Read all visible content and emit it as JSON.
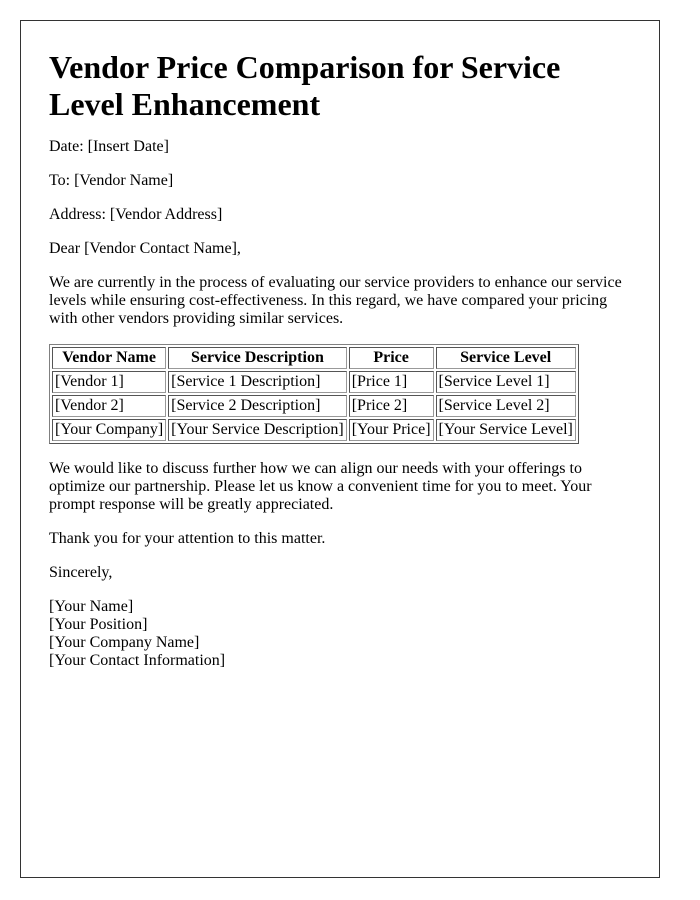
{
  "letter": {
    "title": "Vendor Price Comparison for Service Level Enhancement",
    "date_line": "Date: [Insert Date]",
    "to_line": "To: [Vendor Name]",
    "address_line": "Address: [Vendor Address]",
    "salutation": "Dear [Vendor Contact Name],",
    "intro_paragraph": "We are currently in the process of evaluating our service providers to enhance our service levels while ensuring cost-effectiveness. In this regard, we have compared your pricing with other vendors providing similar services.",
    "table": {
      "headers": [
        "Vendor Name",
        "Service Description",
        "Price",
        "Service Level"
      ],
      "rows": [
        [
          "[Vendor 1]",
          "[Service 1 Description]",
          "[Price 1]",
          "[Service Level 1]"
        ],
        [
          "[Vendor 2]",
          "[Service 2 Description]",
          "[Price 2]",
          "[Service Level 2]"
        ],
        [
          "[Your Company]",
          "[Your Service Description]",
          "[Your Price]",
          "[Your Service Level]"
        ]
      ]
    },
    "followup_paragraph": "We would like to discuss further how we can align our needs with your offerings to optimize our partnership. Please let us know a convenient time for you to meet. Your prompt response will be greatly appreciated.",
    "thanks_line": "Thank you for your attention to this matter.",
    "closing": "Sincerely,",
    "signature": {
      "name": "[Your Name]",
      "position": "[Your Position]",
      "company": "[Your Company Name]",
      "contact": "[Your Contact Information]"
    }
  }
}
